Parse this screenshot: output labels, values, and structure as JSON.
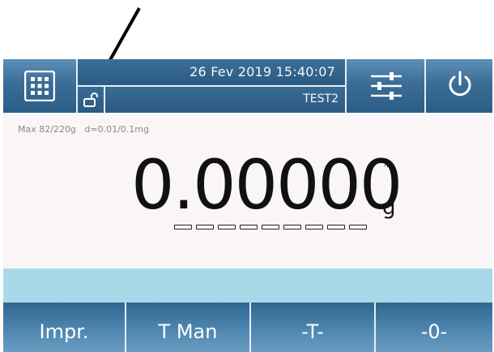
{
  "header": {
    "datetime": "26 Fev 2019 15:40:07",
    "user": "TEST2",
    "icons": [
      "grid-menu-icon",
      "unlocked-padlock-icon",
      "sliders-icon",
      "power-icon"
    ]
  },
  "display": {
    "capacity": "Max 82/220g   d=0.01/0.1mg",
    "weight": "0.00000",
    "stability_mark": "*",
    "unit": "g",
    "bargraph_segments": 9
  },
  "function_keys": {
    "print": "Impr.",
    "manual_tare": "T Man",
    "tare": "-T-",
    "zero": "-0-"
  },
  "colors": {
    "header_blue": "#3b6d97",
    "display_bg": "#faf6f7",
    "info_band": "#a9d9e8",
    "key_blue": "#4f86b0"
  }
}
